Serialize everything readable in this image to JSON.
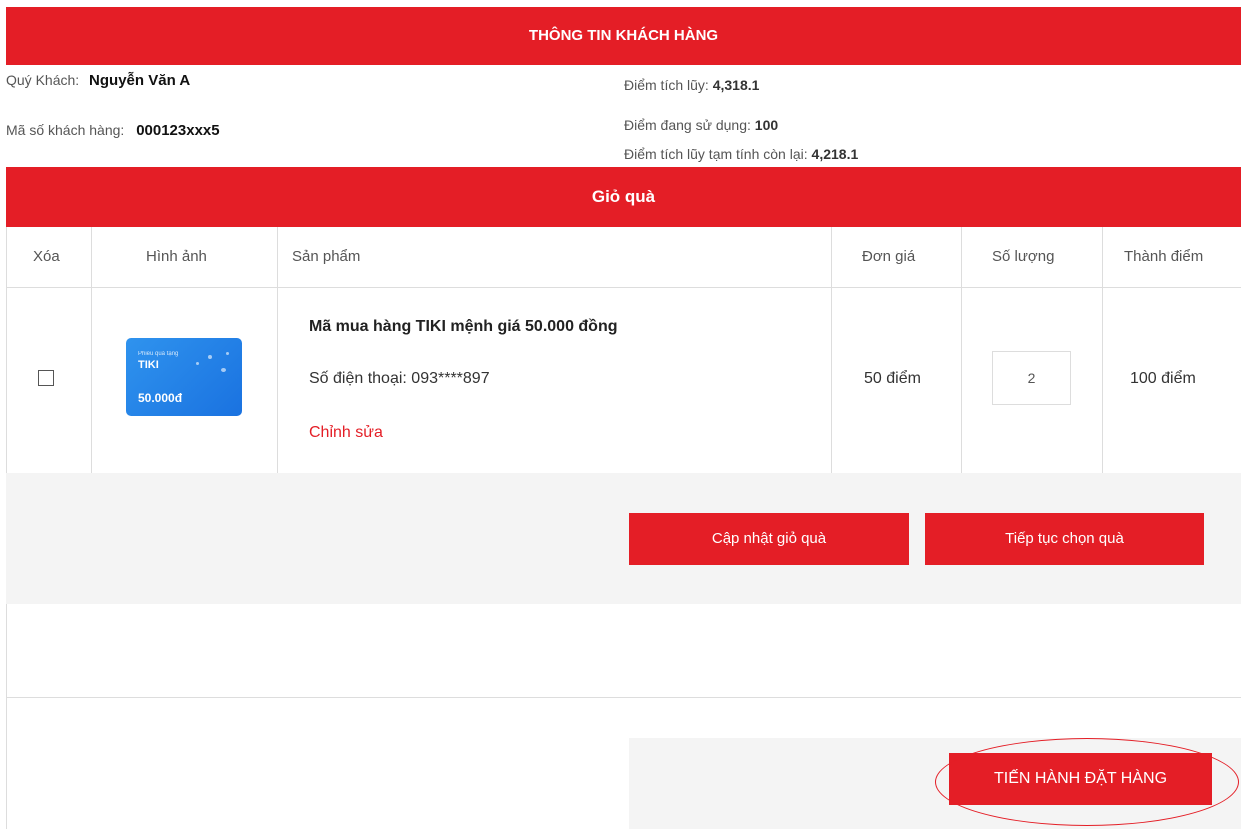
{
  "customer": {
    "header": "THÔNG TIN KHÁCH HÀNG",
    "name_label": "Quý Khách:",
    "name_value": "Nguyễn Văn A",
    "id_label": "Mã số khách hàng:",
    "id_value": "000123xxx5",
    "points_label": "Điểm tích lũy:",
    "points_value": "4,318.1",
    "used_label": "Điểm đang sử dụng:",
    "used_value": "100",
    "remaining_label": "Điểm tích lũy tạm tính còn lại:",
    "remaining_value": "4,218.1"
  },
  "cart": {
    "header": "Giỏ quà",
    "columns": [
      "Xóa",
      "Hình ảnh",
      "Sản phẩm",
      "Đơn giá",
      "Số lượng",
      "Thành điểm"
    ],
    "item": {
      "name": "Mã mua hàng TIKI mệnh giá 50.000 đồng",
      "phone": "Số điện thoại: 093****897",
      "edit": "Chỉnh sửa",
      "unit_price": "50 điểm",
      "quantity": "2",
      "total": "100 điểm",
      "card_brand": "TIKI",
      "card_amount": "50.000đ",
      "card_small": "Phiếu quà tặng"
    }
  },
  "buttons": {
    "update": "Cập nhật giỏ quà",
    "continue": "Tiếp tục chọn quà",
    "order": "TIẾN HÀNH ĐẶT HÀNG"
  },
  "colors": {
    "accent": "#e41e26",
    "card": "#2f93ee"
  }
}
